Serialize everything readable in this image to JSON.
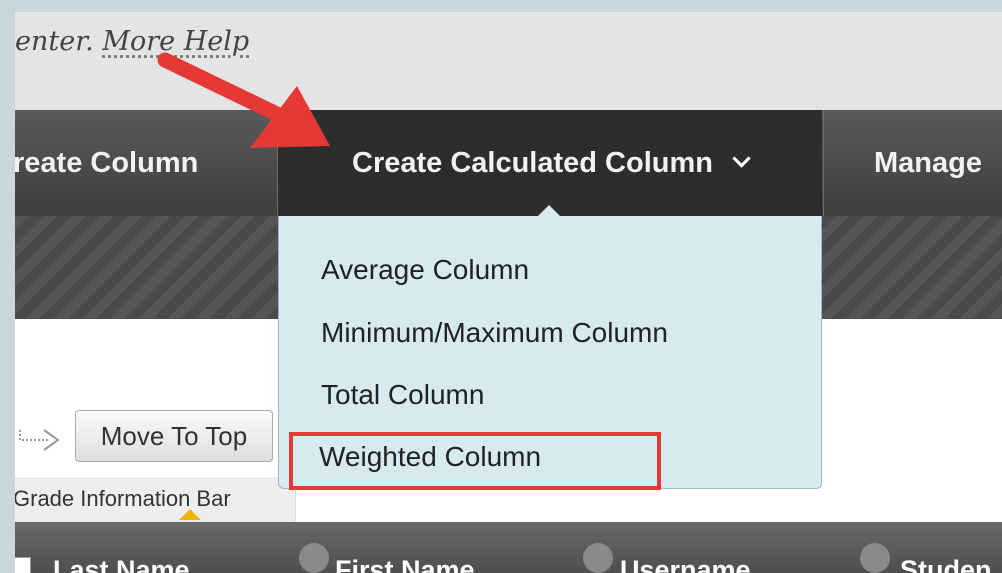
{
  "help": {
    "text": "enter.",
    "link": "More Help"
  },
  "action_bar": {
    "create_column": "reate Column",
    "create_calculated": "Create Calculated Column",
    "manage": "Manage"
  },
  "dropdown": {
    "items": [
      "Average Column",
      "Minimum/Maximum Column",
      "Total Column",
      "Weighted Column"
    ],
    "highlighted": "Weighted Column"
  },
  "toolbar": {
    "move_to_top": "Move To Top",
    "grade_info_bar": "Grade Information Bar"
  },
  "table": {
    "columns": [
      "Last Name",
      "First Name",
      "Username",
      "Studen"
    ]
  },
  "colors": {
    "action_bar": "#4a4a4a",
    "dropdown_bg": "#d6eaf0",
    "annotation_red": "#e53935",
    "grade_marker": "#f0b400"
  }
}
